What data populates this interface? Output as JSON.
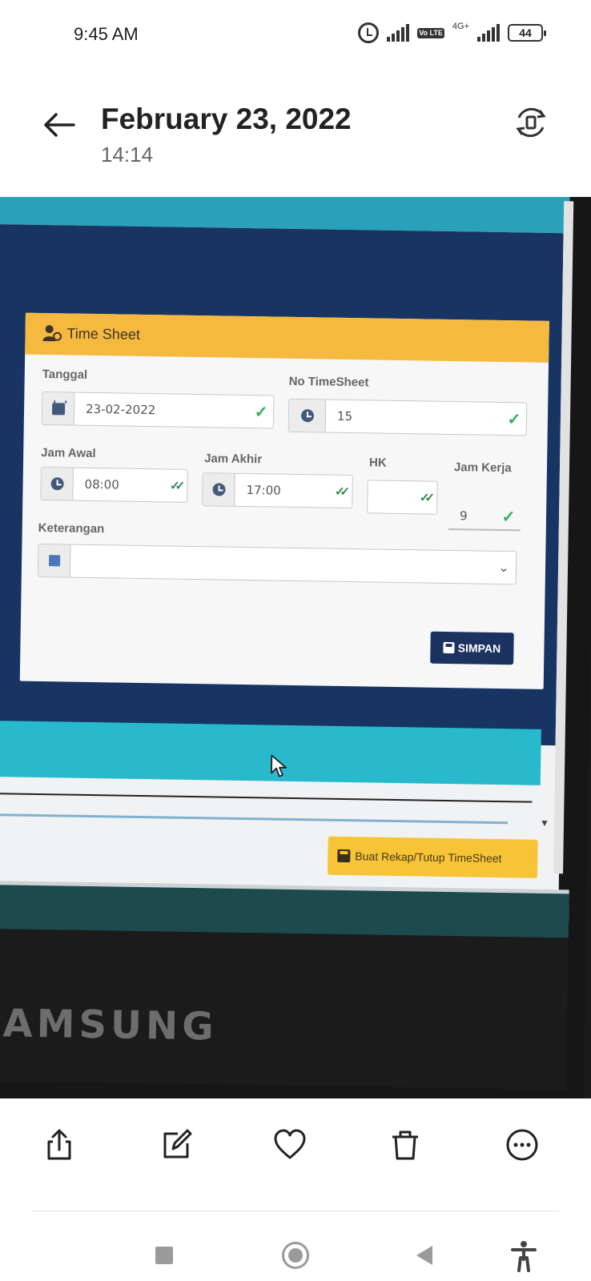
{
  "status_bar": {
    "time": "9:45 AM",
    "network": "4G+",
    "volte": "Vo LTE",
    "battery": "44"
  },
  "header": {
    "title": "February 23, 2022",
    "subtitle": "14:14"
  },
  "photo": {
    "card": {
      "title": "Time Sheet",
      "fields": {
        "tanggal": {
          "label": "Tanggal",
          "value": "23-02-2022"
        },
        "no_timesheet": {
          "label": "No TimeSheet",
          "value": "15"
        },
        "jam_awal": {
          "label": "Jam Awal",
          "value": "08:00"
        },
        "jam_akhir": {
          "label": "Jam Akhir",
          "value": "17:00"
        },
        "hk": {
          "label": "HK",
          "value": ""
        },
        "jam_kerja": {
          "label": "Jam Kerja",
          "value": "9"
        },
        "keterangan": {
          "label": "Keterangan",
          "value": ""
        }
      },
      "save_label": "SIMPAN"
    },
    "rekap_label": "Buat Rekap/Tutup TimeSheet",
    "monitor_brand": "SAMSUNG",
    "colors": {
      "teal": "#2aa1b9",
      "navy": "#173463",
      "card_header": "#f6b940",
      "save_button": "#1c3260",
      "rekap_button": "#f6c436",
      "check": "#2eae5d"
    }
  },
  "toolbar": {
    "icons": [
      "share-icon",
      "edit-icon",
      "heart-icon",
      "trash-icon",
      "more-icon"
    ]
  },
  "navbar": {
    "icons": [
      "recents-icon",
      "home-icon",
      "back-icon",
      "accessibility-icon"
    ]
  }
}
